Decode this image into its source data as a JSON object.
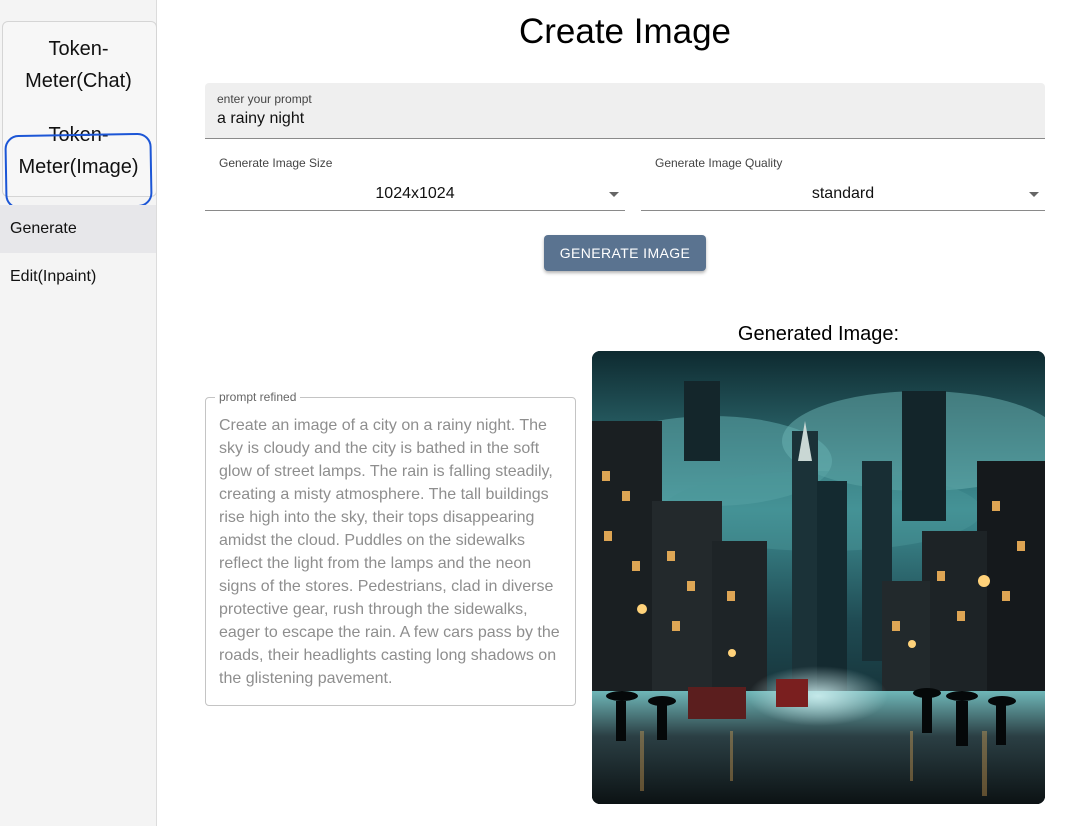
{
  "sidebar": {
    "apps": [
      {
        "label": "Token-Meter(Chat)"
      },
      {
        "label": "Token-Meter(Image)"
      }
    ],
    "nav": [
      {
        "label": "Generate",
        "selected": true
      },
      {
        "label": "Edit(Inpaint)",
        "selected": false
      }
    ]
  },
  "main": {
    "title": "Create Image",
    "prompt": {
      "label": "enter your prompt",
      "value": "a rainy night"
    },
    "size_select": {
      "label": "Generate Image Size",
      "value": "1024x1024"
    },
    "quality_select": {
      "label": "Generate Image Quality",
      "value": "standard"
    },
    "generate_button": "GENERATE IMAGE",
    "refined": {
      "label": "prompt refined",
      "text": "Create an image of a city on a rainy night. The sky is cloudy and the city is bathed in the soft glow of street lamps. The rain is falling steadily, creating a misty atmosphere. The tall buildings rise high into the sky, their tops disappearing amidst the cloud. Puddles on the sidewalks reflect the light from the lamps and the neon signs of the stores. Pedestrians, clad in diverse protective gear, rush through the sidewalks, eager to escape the rain. A few cars pass by the roads, their headlights casting long shadows on the glistening pavement."
    },
    "generated": {
      "caption": "Generated Image:"
    }
  },
  "colors": {
    "button_bg": "#5a7390",
    "highlight_ring": "#1c56d6",
    "selected_nav_bg": "#e7e7ea"
  }
}
